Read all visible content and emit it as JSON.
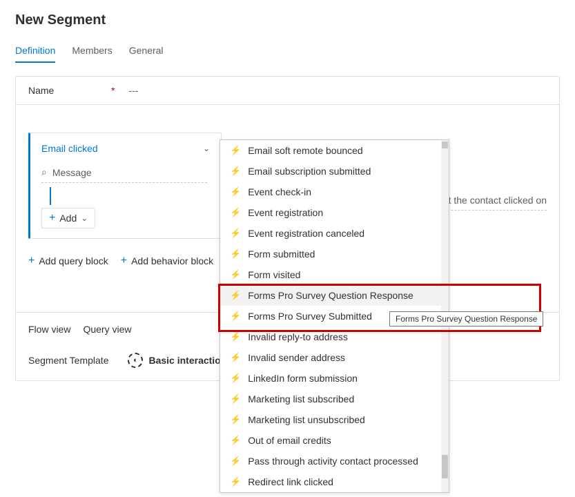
{
  "page_title": "New Segment",
  "tabs": {
    "definition": "Definition",
    "members": "Members",
    "general": "General"
  },
  "name_field": {
    "label": "Name",
    "required_mark": "*",
    "value": "---"
  },
  "query_block": {
    "title": "Email clicked",
    "message_label": "Message",
    "add_label": "Add",
    "hint_text": "ail that the contact clicked on"
  },
  "actions": {
    "add_query": "Add query block",
    "add_behavior": "Add behavior block"
  },
  "footer": {
    "flow_view": "Flow view",
    "query_view": "Query view",
    "tpl_label": "Segment Template",
    "tpl_name": "Basic interaction"
  },
  "dropdown": {
    "items": [
      "Email soft remote bounced",
      "Email subscription submitted",
      "Event check-in",
      "Event registration",
      "Event registration canceled",
      "Form submitted",
      "Form visited",
      "Forms Pro Survey Question Response",
      "Forms Pro Survey Submitted",
      "Invalid reply-to address",
      "Invalid sender address",
      "LinkedIn form submission",
      "Marketing list subscribed",
      "Marketing list unsubscribed",
      "Out of email credits",
      "Pass through activity contact processed",
      "Redirect link clicked"
    ],
    "highlight_index": 7
  },
  "tooltip_text": "Forms Pro Survey Question Response"
}
